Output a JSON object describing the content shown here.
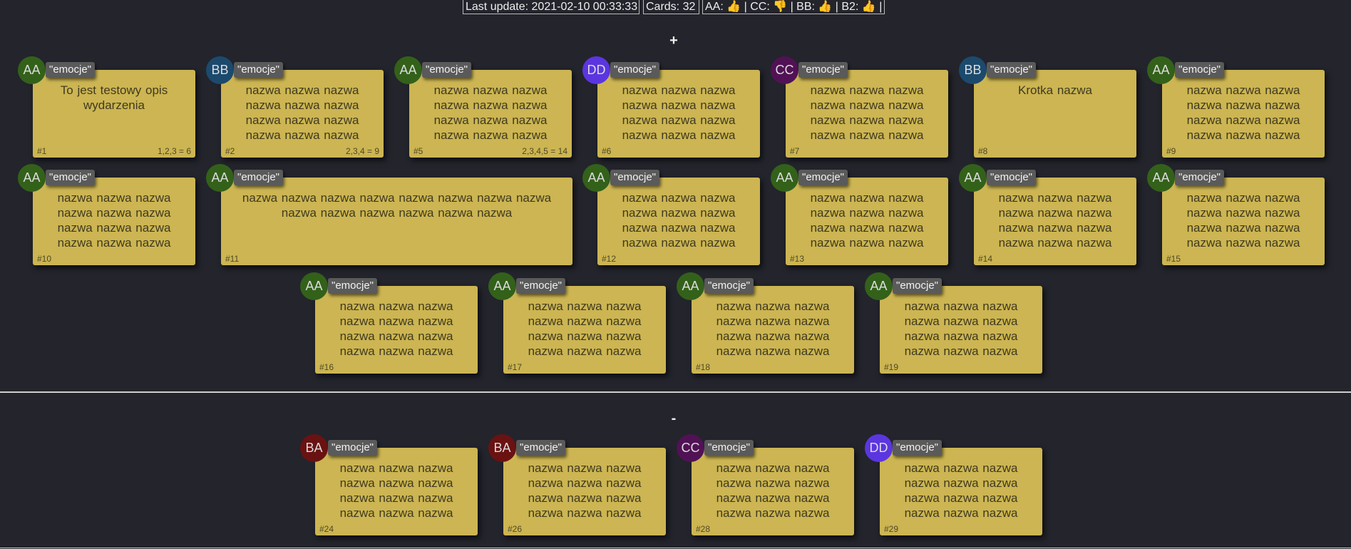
{
  "status": {
    "last_update": "Last update: 2021-02-10 00:33:33",
    "cards": "Cards: 32",
    "votes": "AA: 👍 | CC: 👎 | BB: 👍 | B2: 👍 |"
  },
  "sections": {
    "plus": "+",
    "minus": "-"
  },
  "colors": {
    "AA": "#33611a",
    "BB": "#1c4a6d",
    "CC": "#511255",
    "DD": "#5b36e0",
    "BA": "#6a1212",
    "card": "#ccb552"
  },
  "cards": [
    {
      "id": "#1",
      "user": "AA",
      "tag": "\"emocje\"",
      "text": "To jest testowy opis wydarzenia",
      "sum": "1,2,3 = 6"
    },
    {
      "id": "#2",
      "user": "BB",
      "tag": "\"emocje\"",
      "text": "nazwa nazwa nazwa nazwa nazwa nazwa nazwa nazwa nazwa nazwa nazwa nazwa",
      "sum": "2,3,4 = 9"
    },
    {
      "id": "#5",
      "user": "AA",
      "tag": "\"emocje\"",
      "text": "nazwa nazwa nazwa nazwa nazwa nazwa nazwa nazwa nazwa nazwa nazwa nazwa",
      "sum": "2,3,4,5 = 14"
    },
    {
      "id": "#6",
      "user": "DD",
      "tag": "\"emocje\"",
      "text": "nazwa nazwa nazwa nazwa nazwa nazwa nazwa nazwa nazwa nazwa nazwa nazwa",
      "sum": ""
    },
    {
      "id": "#7",
      "user": "CC",
      "tag": "\"emocje\"",
      "text": "nazwa nazwa nazwa nazwa nazwa nazwa nazwa nazwa nazwa nazwa nazwa nazwa",
      "sum": ""
    },
    {
      "id": "#8",
      "user": "BB",
      "tag": "\"emocje\"",
      "text": "Krotka nazwa",
      "sum": ""
    },
    {
      "id": "#9",
      "user": "AA",
      "tag": "\"emocje\"",
      "text": "nazwa nazwa nazwa nazwa nazwa nazwa nazwa nazwa nazwa nazwa nazwa nazwa",
      "sum": ""
    },
    {
      "id": "#10",
      "user": "AA",
      "tag": "\"emocje\"",
      "text": "nazwa nazwa nazwa nazwa nazwa nazwa nazwa nazwa nazwa nazwa nazwa nazwa",
      "sum": ""
    },
    {
      "id": "#11",
      "user": "AA",
      "tag": "\"emocje\"",
      "text": "nazwa nazwa nazwa nazwa nazwa nazwa nazwa nazwa nazwa nazwa nazwa nazwa nazwa nazwa",
      "sum": ""
    },
    {
      "id": "#12",
      "user": "AA",
      "tag": "\"emocje\"",
      "text": "nazwa nazwa nazwa nazwa nazwa nazwa nazwa nazwa nazwa nazwa nazwa nazwa",
      "sum": ""
    },
    {
      "id": "#13",
      "user": "AA",
      "tag": "\"emocje\"",
      "text": "nazwa nazwa nazwa nazwa nazwa nazwa nazwa nazwa nazwa nazwa nazwa nazwa",
      "sum": ""
    },
    {
      "id": "#14",
      "user": "AA",
      "tag": "\"emocje\"",
      "text": "nazwa nazwa nazwa nazwa nazwa nazwa nazwa nazwa nazwa nazwa nazwa nazwa",
      "sum": ""
    },
    {
      "id": "#15",
      "user": "AA",
      "tag": "\"emocje\"",
      "text": "nazwa nazwa nazwa nazwa nazwa nazwa nazwa nazwa nazwa nazwa nazwa nazwa",
      "sum": ""
    },
    {
      "id": "#16",
      "user": "AA",
      "tag": "\"emocje\"",
      "text": "nazwa nazwa nazwa nazwa nazwa nazwa nazwa nazwa nazwa nazwa nazwa nazwa",
      "sum": ""
    },
    {
      "id": "#17",
      "user": "AA",
      "tag": "\"emocje\"",
      "text": "nazwa nazwa nazwa nazwa nazwa nazwa nazwa nazwa nazwa nazwa nazwa nazwa",
      "sum": ""
    },
    {
      "id": "#18",
      "user": "AA",
      "tag": "\"emocje\"",
      "text": "nazwa nazwa nazwa nazwa nazwa nazwa nazwa nazwa nazwa nazwa nazwa nazwa",
      "sum": ""
    },
    {
      "id": "#19",
      "user": "AA",
      "tag": "\"emocje\"",
      "text": "nazwa nazwa nazwa nazwa nazwa nazwa nazwa nazwa nazwa nazwa nazwa nazwa",
      "sum": ""
    },
    {
      "id": "#24",
      "user": "BA",
      "tag": "\"emocje\"",
      "text": "nazwa nazwa nazwa nazwa nazwa nazwa nazwa nazwa nazwa nazwa nazwa nazwa",
      "sum": ""
    },
    {
      "id": "#26",
      "user": "BA",
      "tag": "\"emocje\"",
      "text": "nazwa nazwa nazwa nazwa nazwa nazwa nazwa nazwa nazwa nazwa nazwa nazwa",
      "sum": ""
    },
    {
      "id": "#28",
      "user": "CC",
      "tag": "\"emocje\"",
      "text": "nazwa nazwa nazwa nazwa nazwa nazwa nazwa nazwa nazwa nazwa nazwa nazwa",
      "sum": ""
    },
    {
      "id": "#29",
      "user": "DD",
      "tag": "\"emocje\"",
      "text": "nazwa nazwa nazwa nazwa nazwa nazwa nazwa nazwa nazwa nazwa nazwa nazwa",
      "sum": ""
    }
  ]
}
